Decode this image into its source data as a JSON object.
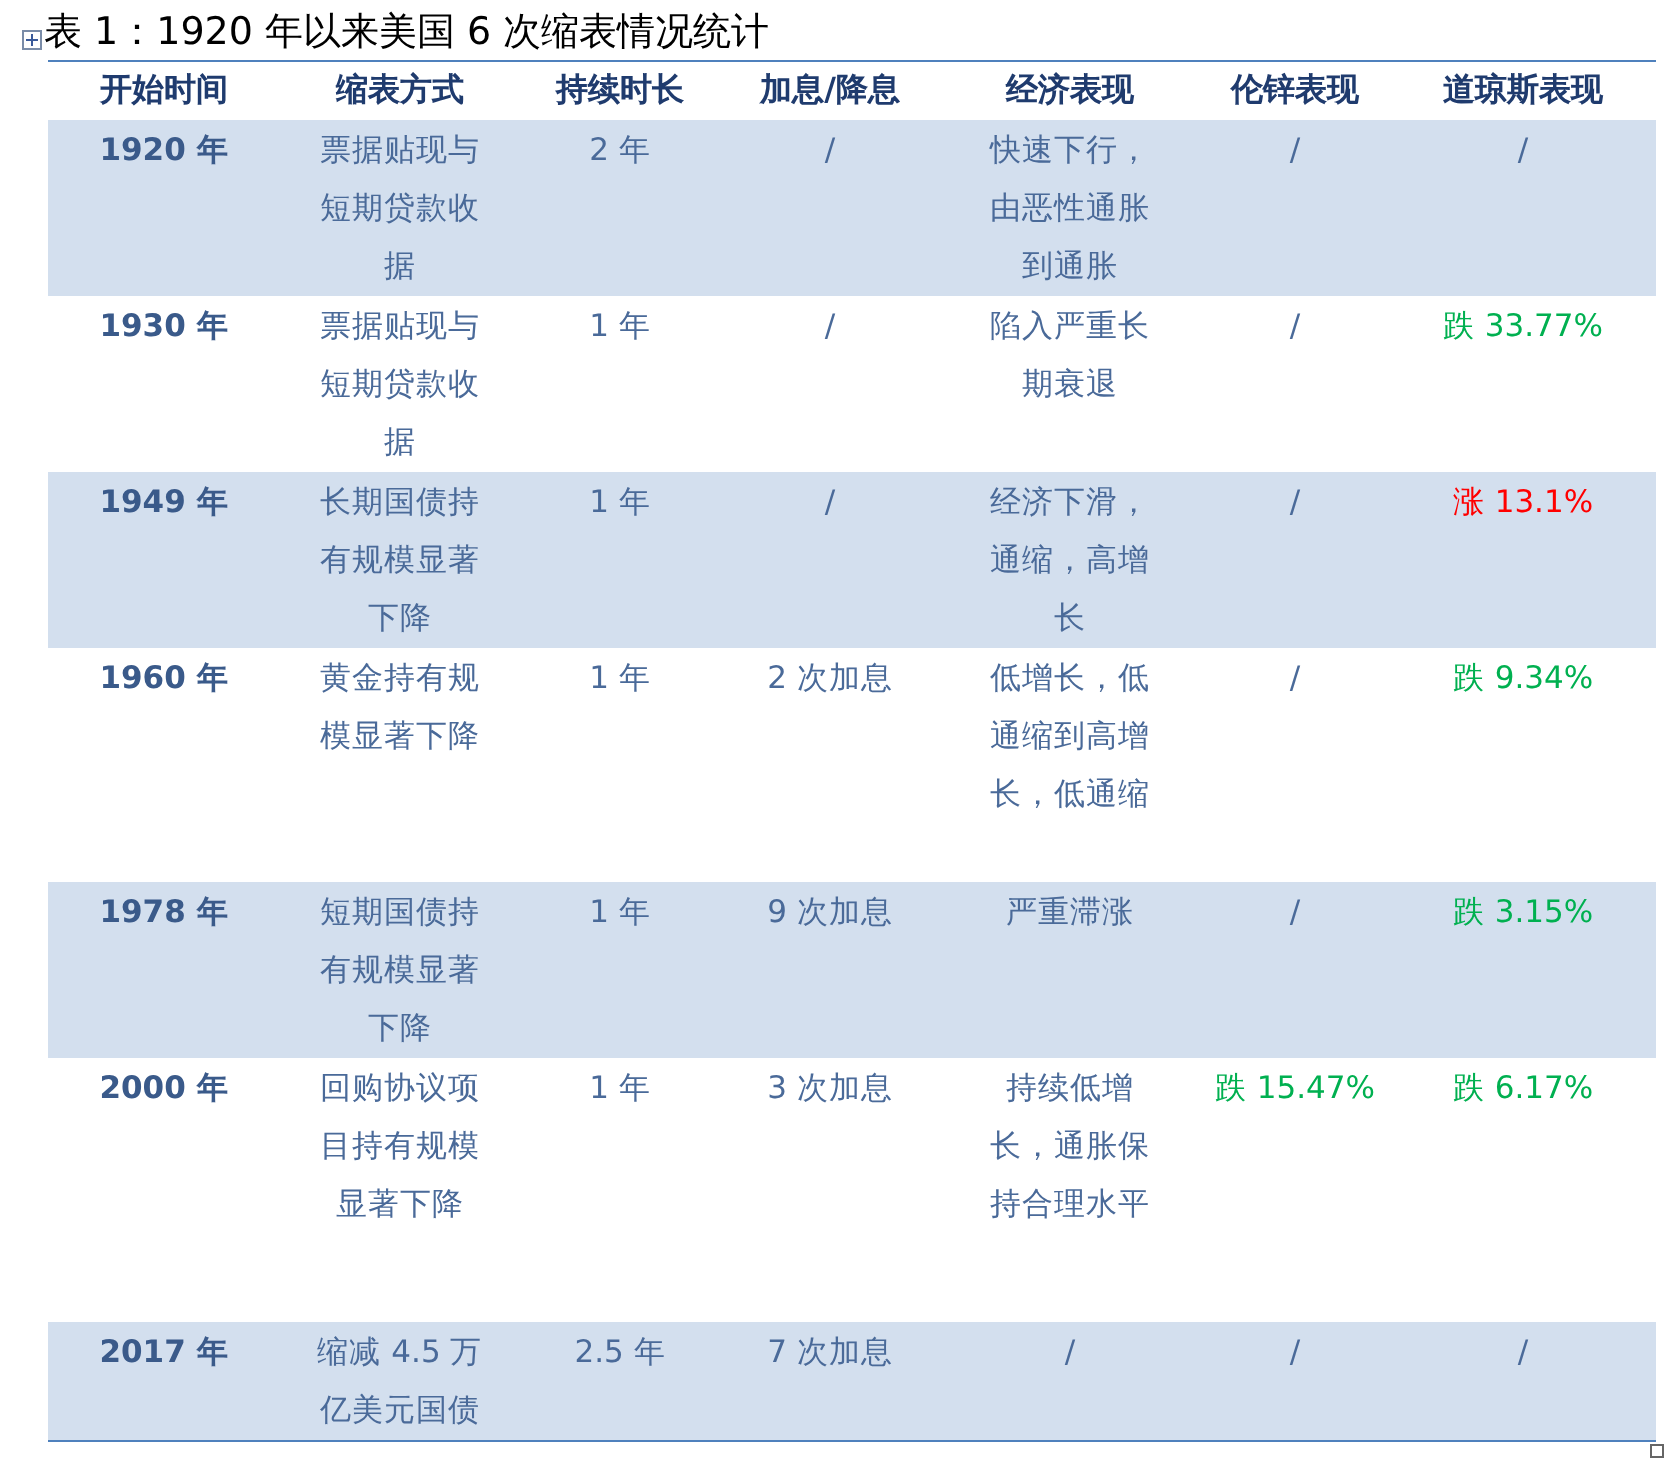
{
  "title": "表 1：1920 年以来美国 6 次缩表情况统计",
  "table": {
    "columns": [
      "开始时间",
      "缩表方式",
      "持续时长",
      "加息/降息",
      "经济表现",
      "伦锌表现",
      "道琼斯表现"
    ],
    "rows": [
      {
        "cells": [
          {
            "text": "1920 年"
          },
          {
            "text": "票据贴现与短期贷款收据"
          },
          {
            "text": "2 年"
          },
          {
            "text": "/"
          },
          {
            "text": "快速下行，由恶性通胀到通胀"
          },
          {
            "text": "/"
          },
          {
            "text": "/"
          }
        ]
      },
      {
        "cells": [
          {
            "text": "1930 年"
          },
          {
            "text": "票据贴现与短期贷款收据"
          },
          {
            "text": "1 年"
          },
          {
            "text": "/"
          },
          {
            "text": "陷入严重长期衰退"
          },
          {
            "text": "/"
          },
          {
            "text": "跌 33.77%",
            "color": "#00b050"
          }
        ]
      },
      {
        "cells": [
          {
            "text": "1949 年"
          },
          {
            "text": "长期国债持有规模显著下降"
          },
          {
            "text": "1 年"
          },
          {
            "text": "/"
          },
          {
            "text": "经济下滑，通缩，高增长"
          },
          {
            "text": "/"
          },
          {
            "text": "涨 13.1%",
            "color": "#ff0000"
          }
        ]
      },
      {
        "cells": [
          {
            "text": "1960 年"
          },
          {
            "text": "黄金持有规模显著下降"
          },
          {
            "text": "1 年"
          },
          {
            "text": "2 次加息"
          },
          {
            "text": "低增长，低通缩到高增长，低通缩"
          },
          {
            "text": "/"
          },
          {
            "text": "跌 9.34%",
            "color": "#00b050"
          }
        ]
      },
      {
        "cells": [
          {
            "text": "1978 年"
          },
          {
            "text": "短期国债持有规模显著下降"
          },
          {
            "text": "1 年"
          },
          {
            "text": "9 次加息"
          },
          {
            "text": "严重滞涨"
          },
          {
            "text": "/"
          },
          {
            "text": "跌 3.15%",
            "color": "#00b050"
          }
        ]
      },
      {
        "cells": [
          {
            "text": "2000 年"
          },
          {
            "text": "回购协议项目持有规模显著下降"
          },
          {
            "text": "1 年"
          },
          {
            "text": "3 次加息"
          },
          {
            "text": "持续低增长，通胀保持合理水平"
          },
          {
            "text": "跌 15.47%",
            "color": "#00b050"
          },
          {
            "text": "跌 6.17%",
            "color": "#00b050"
          }
        ]
      },
      {
        "cells": [
          {
            "text": "2017 年"
          },
          {
            "text": "缩减 4.5 万亿美元国债"
          },
          {
            "text": "2.5 年"
          },
          {
            "text": "7 次加息"
          },
          {
            "text": "/"
          },
          {
            "text": "/"
          },
          {
            "text": "/"
          }
        ]
      }
    ]
  }
}
